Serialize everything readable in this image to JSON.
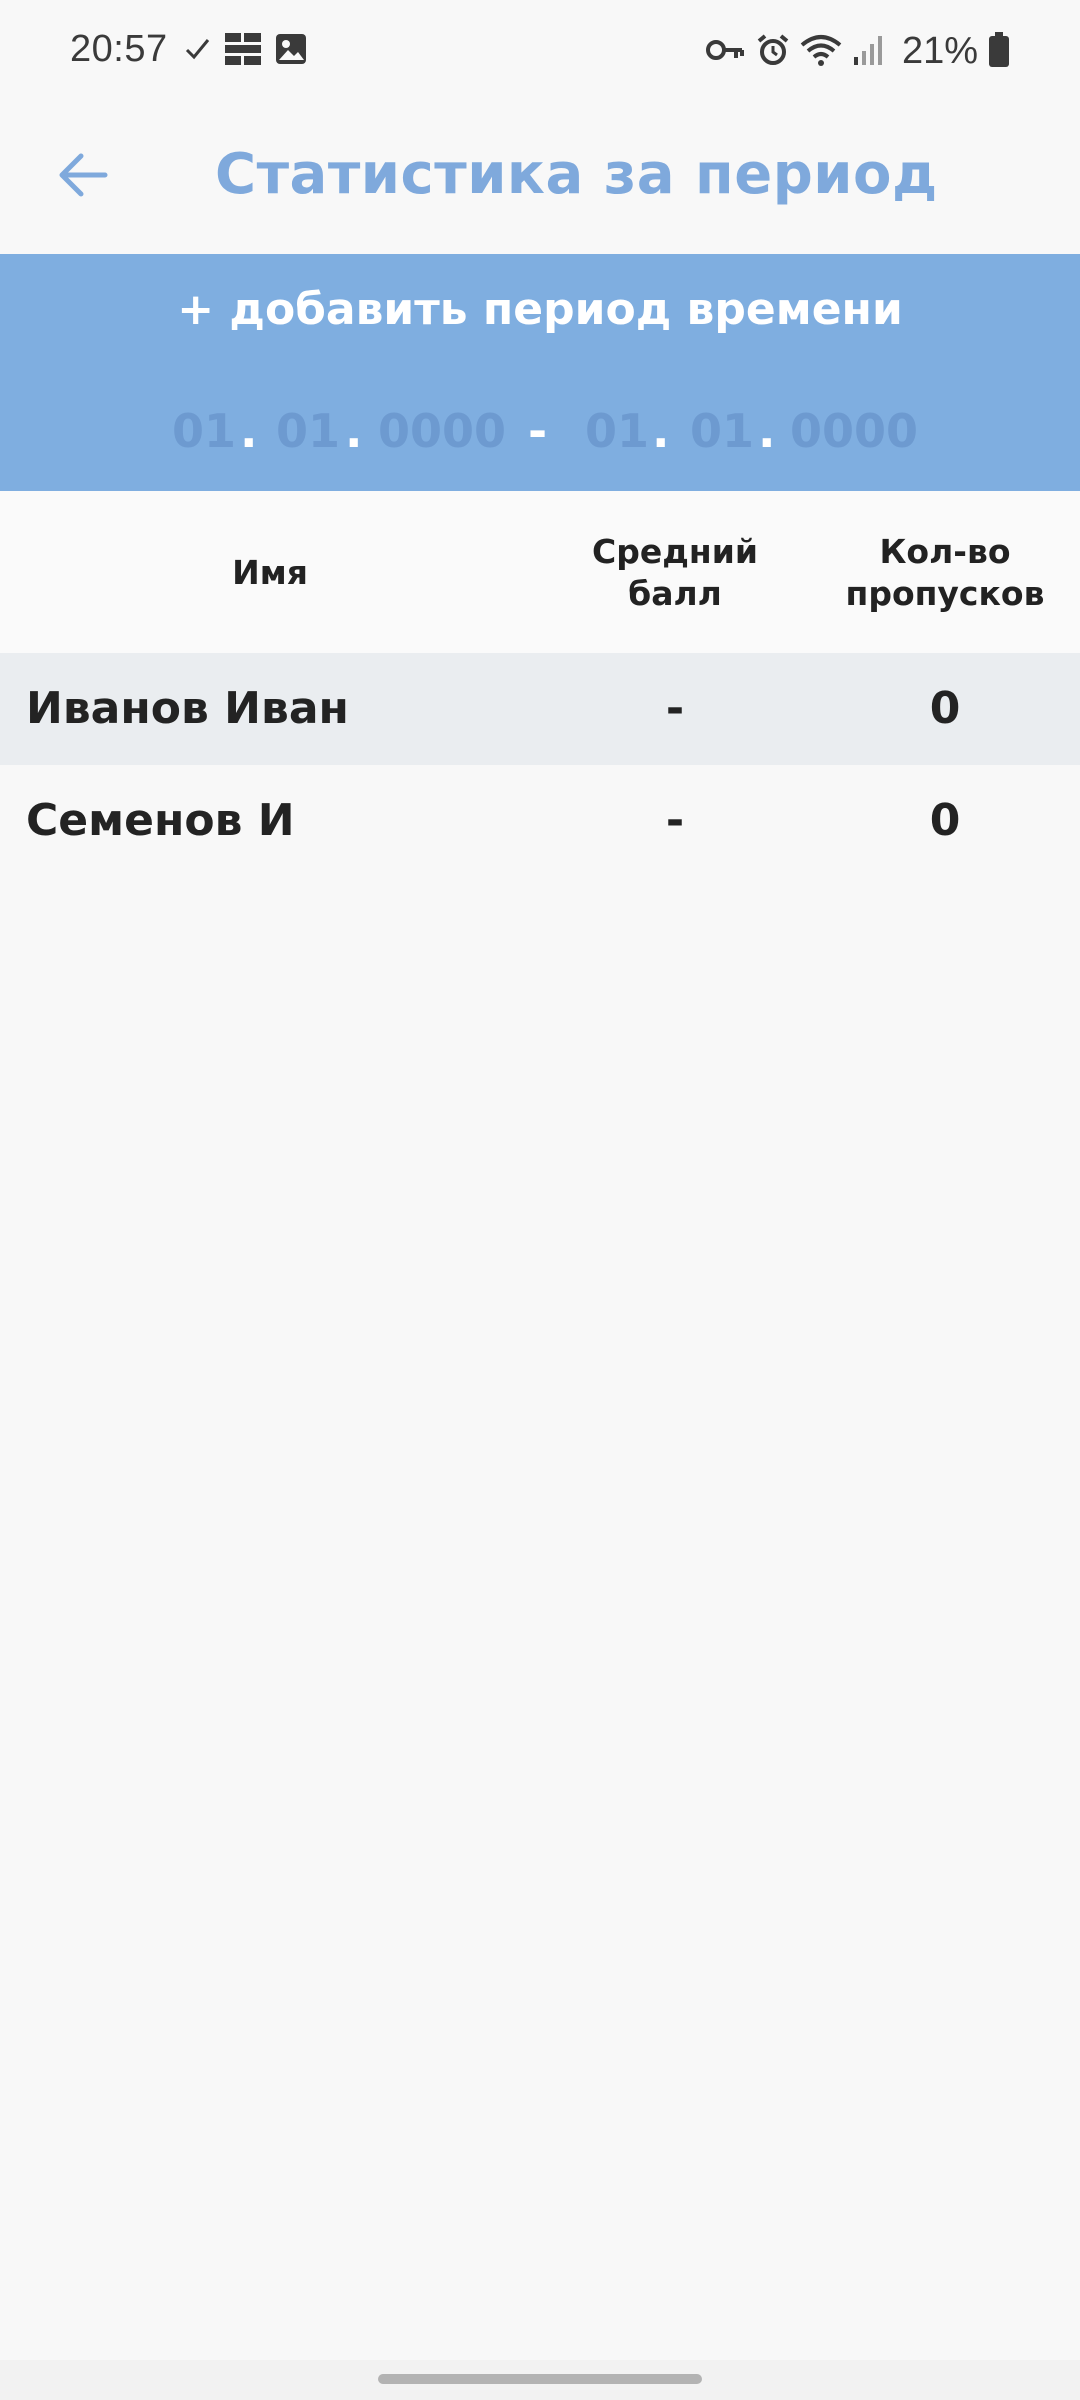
{
  "status_bar": {
    "time": "20:57",
    "battery": "21%",
    "left_icons": [
      "check-icon",
      "grid-app-icon",
      "gallery-icon"
    ],
    "right_icons": [
      "vpn-key-icon",
      "alarm-icon",
      "wifi-icon",
      "signal-icon",
      "battery-icon"
    ]
  },
  "app_bar": {
    "title": "Статистика за период",
    "back_icon": "arrow-back-icon",
    "accent_color": "#7fa9dc"
  },
  "period": {
    "add_label": "+ добавить период времени",
    "start": {
      "day": "01",
      "month": "01",
      "year": "0000"
    },
    "end": {
      "day": "01",
      "month": "01",
      "year": "0000"
    },
    "dot": ".",
    "dash": "-",
    "panel_color": "#7faee0"
  },
  "table": {
    "headers": {
      "name": "Имя",
      "avg_line1": "Средний",
      "avg_line2": "балл",
      "skips_line1": "Кол-во",
      "skips_line2": "пропусков"
    },
    "rows": [
      {
        "name": "Иванов Иван",
        "avg": "-",
        "skips": "0"
      },
      {
        "name": "Семенов И",
        "avg": "-",
        "skips": "0"
      }
    ]
  }
}
